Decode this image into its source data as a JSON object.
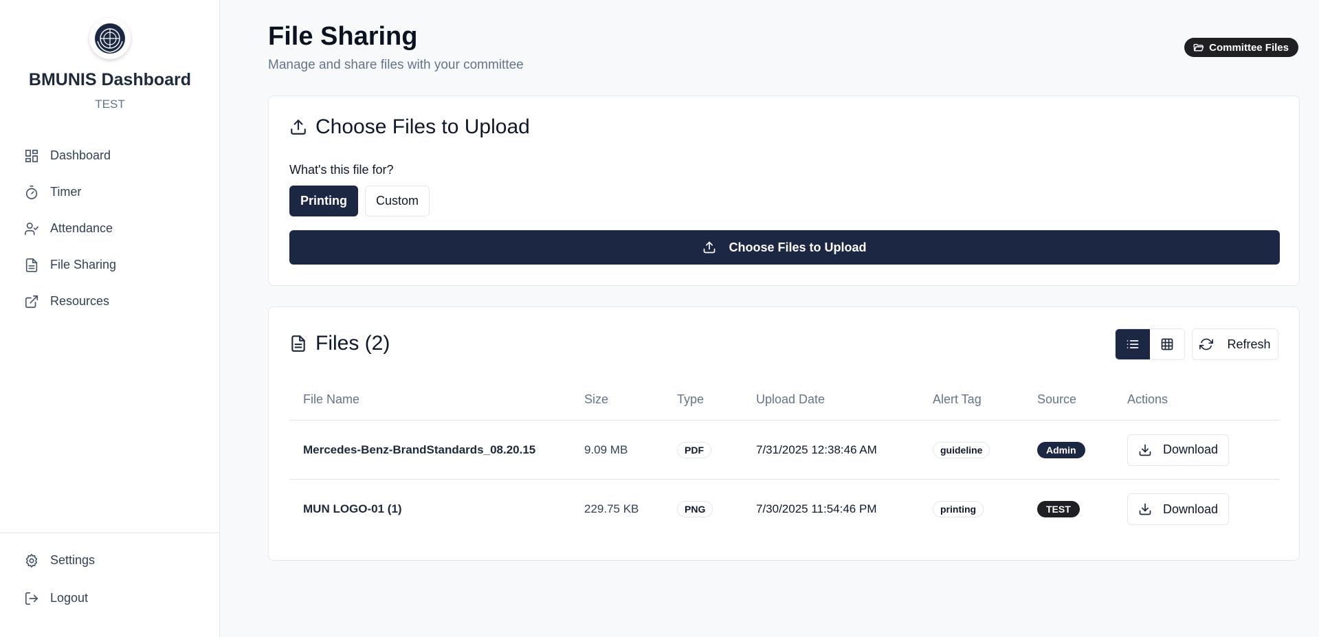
{
  "sidebar": {
    "title": "BMUNIS Dashboard",
    "subtitle": "TEST",
    "items": [
      {
        "label": "Dashboard",
        "icon": "dashboard-icon"
      },
      {
        "label": "Timer",
        "icon": "timer-icon"
      },
      {
        "label": "Attendance",
        "icon": "user-check-icon"
      },
      {
        "label": "File Sharing",
        "icon": "file-icon"
      },
      {
        "label": "Resources",
        "icon": "external-link-icon"
      }
    ],
    "bottom": [
      {
        "label": "Settings",
        "icon": "gear-icon"
      },
      {
        "label": "Logout",
        "icon": "logout-icon"
      }
    ]
  },
  "header": {
    "title": "File Sharing",
    "subtitle": "Manage and share files with your committee",
    "committee_button": "Committee Files"
  },
  "upload": {
    "title": "Choose Files to Upload",
    "purpose_label": "What's this file for?",
    "options": [
      "Printing",
      "Custom"
    ],
    "selected": "Printing",
    "button_label": "Choose Files to Upload"
  },
  "files": {
    "title": "Files (2)",
    "refresh_label": "Refresh",
    "columns": [
      "File Name",
      "Size",
      "Type",
      "Upload Date",
      "Alert Tag",
      "Source",
      "Actions"
    ],
    "rows": [
      {
        "name": "Mercedes-Benz-BrandStandards_08.20.15",
        "size": "9.09 MB",
        "type": "PDF",
        "date": "7/31/2025 12:38:46 AM",
        "tag": "guideline",
        "source": "Admin",
        "action": "Download"
      },
      {
        "name": "MUN LOGO-01 (1)",
        "size": "229.75 KB",
        "type": "PNG",
        "date": "7/30/2025 11:54:46 PM",
        "tag": "printing",
        "source": "TEST",
        "action": "Download"
      }
    ]
  },
  "colors": {
    "primary": "#1c2744",
    "background": "#f8f9fb",
    "badge_dark": "#1f1f24"
  }
}
